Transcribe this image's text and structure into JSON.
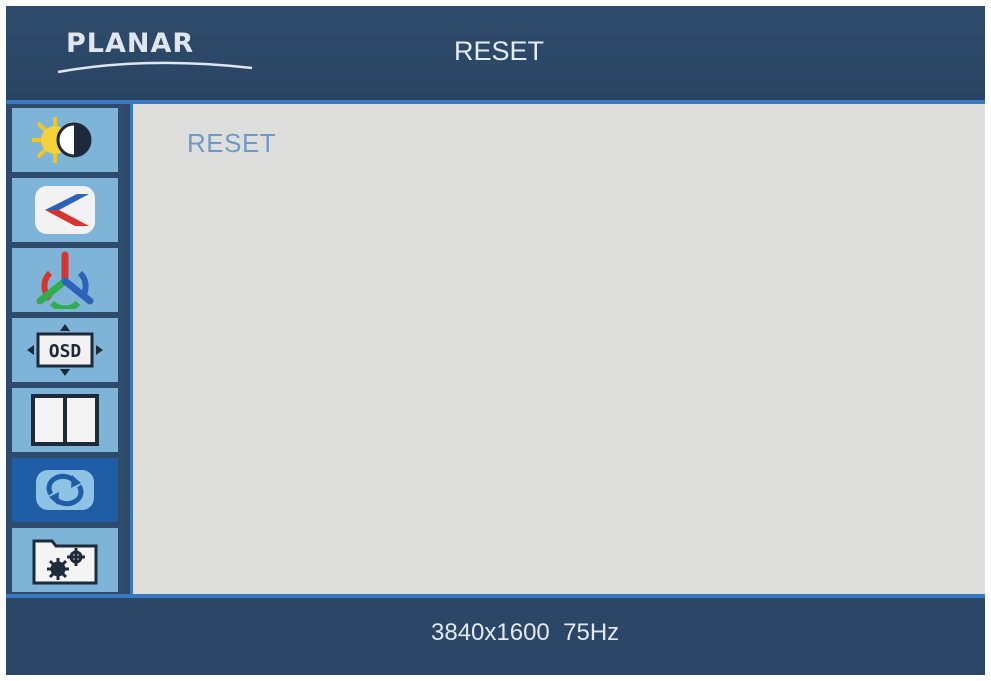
{
  "header": {
    "logo_text": "PLANAR",
    "title": "RESET"
  },
  "sidebar": {
    "items": [
      {
        "icon": "brightness-contrast-icon",
        "selected": false
      },
      {
        "icon": "image-adjust-icon",
        "selected": false
      },
      {
        "icon": "color-icon",
        "selected": false
      },
      {
        "icon": "osd-settings-icon",
        "selected": false
      },
      {
        "icon": "pip-split-icon",
        "selected": false
      },
      {
        "icon": "reset-icon",
        "selected": true
      },
      {
        "icon": "setup-icon",
        "selected": false
      }
    ]
  },
  "content": {
    "label": "RESET"
  },
  "footer": {
    "resolution": "3840x1600  75Hz"
  },
  "colors": {
    "frame": "#2c4868",
    "accent_line": "#3a78c2",
    "sidebar_item": "#7fb4d9",
    "sidebar_selected": "#1f5da6",
    "content_bg": "#dedfdc",
    "content_text": "#6e9bc6"
  }
}
